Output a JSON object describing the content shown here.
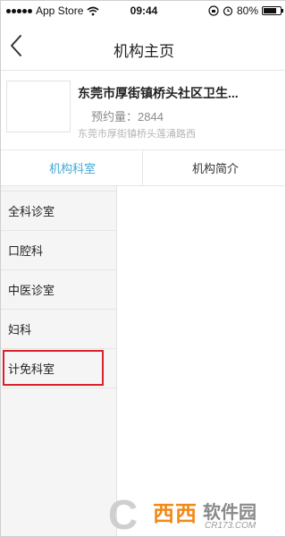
{
  "status_bar": {
    "carrier": "App Store",
    "time": "09:44",
    "battery": "80%",
    "battery_level": 0.8
  },
  "navbar": {
    "title": "机构主页"
  },
  "org": {
    "name": "东莞市厚街镇桥头社区卫生...",
    "count": "预约量：2844",
    "address": "东莞市厚街镇桥头莲涌路西"
  },
  "tabs": [
    {
      "label": "机构科室",
      "active": true
    },
    {
      "label": "机构简介",
      "active": false
    }
  ],
  "departments": [
    {
      "label": "全科诊室"
    },
    {
      "label": "口腔科"
    },
    {
      "label": "中医诊室"
    },
    {
      "label": "妇科"
    },
    {
      "label": "计免科室"
    }
  ],
  "watermark": {
    "brand": "西西",
    "suffix": "软件园",
    "url": "CR173.COM"
  },
  "colors": {
    "accent": "#3fa8d8",
    "highlight": "#d9232d"
  }
}
